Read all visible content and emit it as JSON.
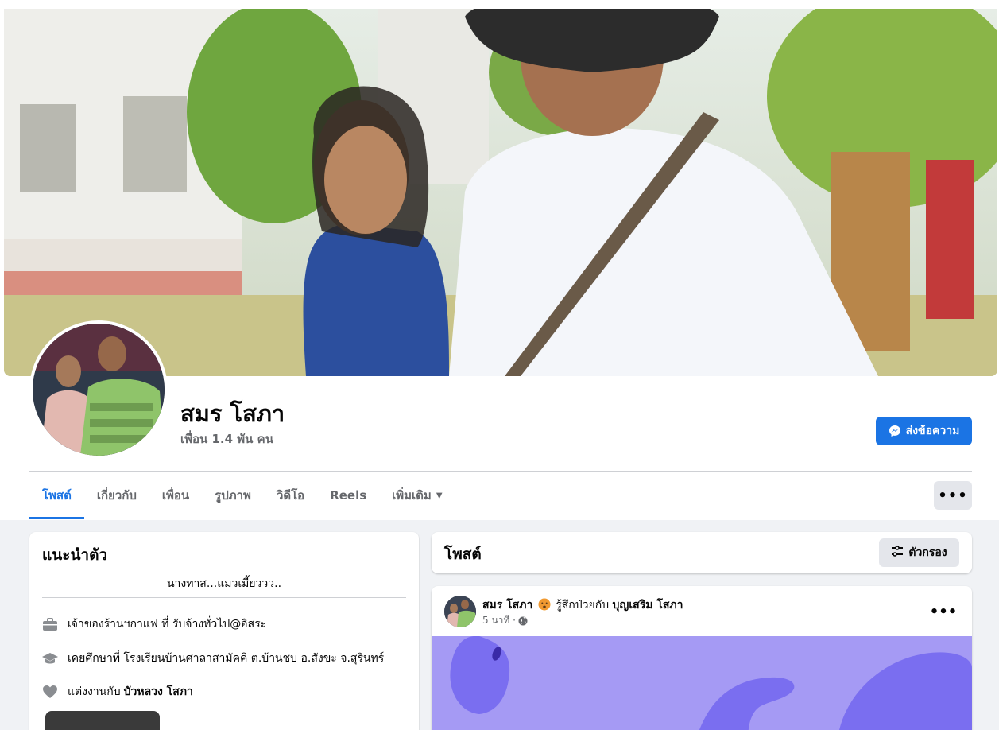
{
  "profile": {
    "name": "สมร โสภา",
    "friends": "เพื่อน 1.4 พัน คน"
  },
  "actions": {
    "message_label": "ส่งข้อความ",
    "more_label": "•••"
  },
  "tabs": [
    {
      "label": "โพสต์",
      "active": true
    },
    {
      "label": "เกี่ยวกับ",
      "active": false
    },
    {
      "label": "เพื่อน",
      "active": false
    },
    {
      "label": "รูปภาพ",
      "active": false
    },
    {
      "label": "วิดีโอ",
      "active": false
    },
    {
      "label": "Reels",
      "active": false
    },
    {
      "label": "เพิ่มเติม",
      "active": false
    }
  ],
  "intro": {
    "title": "แนะนำตัว",
    "bio": "นางทาส...แมวเมี้ยววว..",
    "work": "เจ้าของร้านฯกาแฟ ที่ รับจ้างทั่วไป@อิสระ",
    "education": "เคยศึกษาที่ โรงเรียนบ้านศาลาสามัคคี ต.บ้านชบ อ.สังขะ จ.สุรินทร์",
    "relationship_prefix": "แต่งงานกับ",
    "relationship_name": "บัวหลวง โสภา"
  },
  "posts": {
    "title": "โพสต์",
    "filter_label": "ตัวกรอง"
  },
  "post": {
    "author": "สมร โสภา",
    "feeling": "รู้สึกป่วยกับ",
    "tagged": "บุญเสริม โสภา",
    "time": "5 นาที ·",
    "more_label": "•••"
  },
  "icons": {
    "message": "messenger-icon",
    "filter": "filter-icon",
    "work": "briefcase-icon",
    "education": "graduation-cap-icon",
    "relationship": "heart-icon",
    "privacy": "globe-icon",
    "feeling": "sick-face-icon",
    "dropdown": "caret-down-icon"
  },
  "colors": {
    "accent": "#1b74e4",
    "background": "#f0f2f5",
    "secondary_text": "#65676b",
    "post_background": "#a59af4"
  }
}
